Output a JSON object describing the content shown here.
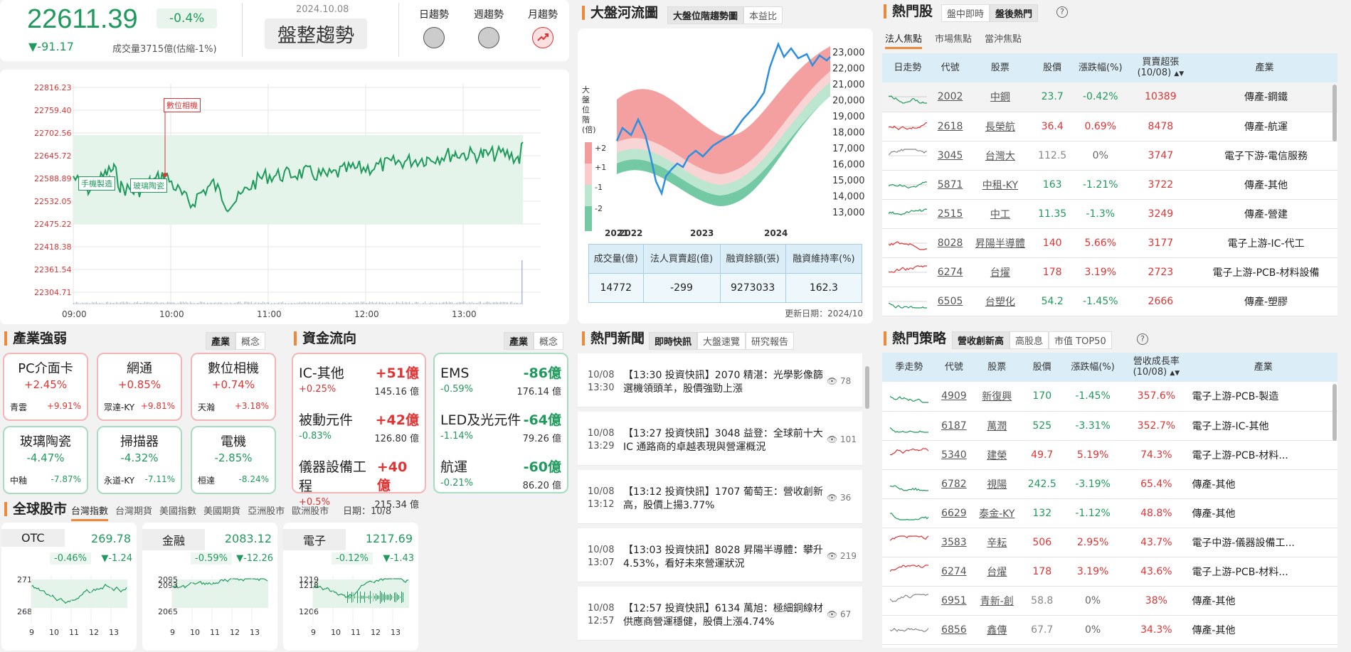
{
  "index": {
    "value": "22611.39",
    "pct": "-0.4%",
    "change": "▼-91.17",
    "volume": "成交量3715億(估縮-1%)",
    "date": "2024.10.08",
    "trend": "盤整趨勢",
    "trend_labels": [
      "日趨勢",
      "週趨勢",
      "月趨勢"
    ]
  },
  "intraday": {
    "yticks": [
      "22816.23",
      "22759.40",
      "22702.56",
      "22645.72",
      "22588.89",
      "22532.05",
      "22475.22",
      "22418.38",
      "22361.54",
      "22304.71"
    ],
    "xticks": [
      "09:00",
      "10:00",
      "11:00",
      "12:00",
      "13:00"
    ],
    "tags": [
      "數位相機",
      "手機製造",
      "玻璃陶瓷"
    ]
  },
  "river": {
    "title": "大盤河流圖",
    "tabs": [
      "大盤位階趨勢圖",
      "本益比"
    ],
    "ylabel": "大盤位階(倍)",
    "bands": [
      "+2",
      "+1",
      "-1",
      "-2"
    ],
    "yticks": [
      "23,000",
      "22,000",
      "21,000",
      "20,000",
      "19,000",
      "18,000",
      "17,000",
      "16,000",
      "15,000",
      "14,000",
      "13,000"
    ],
    "xticks": [
      "2021",
      "2022",
      "2023",
      "2024"
    ],
    "table_headers": [
      "成交量(億)",
      "法人買賣超(億)",
      "融資餘額(張)",
      "融資維持率(%)"
    ],
    "table_values": [
      "14772",
      "-299",
      "9273033",
      "162.3"
    ],
    "update": "更新日期：2024/10"
  },
  "hot": {
    "title": "熱門股",
    "tabs": [
      "盤中即時",
      "盤後熱門"
    ],
    "help": "?",
    "subtabs": [
      "法人焦點",
      "市場焦點",
      "當沖焦點"
    ],
    "headers": [
      "日走勢",
      "代號",
      "股票",
      "股價",
      "漲跌幅(%)",
      "買賣超張\n(10/08)",
      "產業"
    ],
    "rows": [
      [
        "2002",
        "中鋼",
        "23.7",
        "-0.42%",
        "10389",
        "傳產-鋼鐵"
      ],
      [
        "2618",
        "長榮航",
        "36.4",
        "0.69%",
        "8478",
        "傳產-航運"
      ],
      [
        "3045",
        "台灣大",
        "112.5",
        "0%",
        "3747",
        "電子下游-電信服務"
      ],
      [
        "5871",
        "中租-KY",
        "163",
        "-1.21%",
        "3722",
        "傳產-其他"
      ],
      [
        "2515",
        "中工",
        "11.35",
        "-1.3%",
        "3249",
        "傳產-營建"
      ],
      [
        "8028",
        "昇陽半導體",
        "140",
        "5.66%",
        "3177",
        "電子上游-IC-代工"
      ],
      [
        "6274",
        "台燿",
        "178",
        "3.19%",
        "2723",
        "電子上游-PCB-材料設備"
      ],
      [
        "6505",
        "台塑化",
        "54.2",
        "-1.45%",
        "2666",
        "傳產-塑膠"
      ]
    ]
  },
  "strategy": {
    "title": "熱門策略",
    "tabs": [
      "營收創新高",
      "高股息",
      "市值 TOP50"
    ],
    "help": "?",
    "headers": [
      "季走勢",
      "代號",
      "股票",
      "股價",
      "漲跌幅(%)",
      "營收成長率\n(10/08)",
      "產業"
    ],
    "rows": [
      [
        "4909",
        "新復興",
        "170",
        "-1.45%",
        "357.6%",
        "電子上游-PCB-製造"
      ],
      [
        "6187",
        "萬潤",
        "525",
        "-3.31%",
        "352.7%",
        "電子上游-IC-其他"
      ],
      [
        "5340",
        "建榮",
        "49.7",
        "5.19%",
        "74.3%",
        "電子上游-PCB-材料..."
      ],
      [
        "6782",
        "視陽",
        "242.5",
        "-3.19%",
        "65.4%",
        "傳產-其他"
      ],
      [
        "6629",
        "泰金-KY",
        "132",
        "-1.12%",
        "48.8%",
        "傳產-其他"
      ],
      [
        "3583",
        "辛耘",
        "506",
        "2.95%",
        "43.7%",
        "電子中游-儀器設備工..."
      ],
      [
        "6274",
        "台燿",
        "178",
        "3.19%",
        "43.6%",
        "電子上游-PCB-材料..."
      ],
      [
        "6951",
        "青新-創",
        "58.8",
        "0%",
        "38%",
        "傳產-其他"
      ],
      [
        "6856",
        "鑫傳",
        "67.7",
        "0%",
        "34.3%",
        "傳產-其他"
      ]
    ]
  },
  "industry": {
    "title": "產業強弱",
    "tabs": [
      "產業",
      "概念"
    ],
    "boxes": [
      {
        "name": "PC介面卡",
        "pct": "+2.45%",
        "sub": "青雲",
        "subpct": "+9.91%",
        "dir": "up"
      },
      {
        "name": "網通",
        "pct": "+0.85%",
        "sub": "眾達-KY",
        "subpct": "+9.81%",
        "dir": "up"
      },
      {
        "name": "數位相機",
        "pct": "+0.74%",
        "sub": "天瀚",
        "subpct": "+3.18%",
        "dir": "up"
      },
      {
        "name": "玻璃陶瓷",
        "pct": "-4.47%",
        "sub": "中釉",
        "subpct": "-7.87%",
        "dir": "dn"
      },
      {
        "name": "掃描器",
        "pct": "-4.32%",
        "sub": "永道-KY",
        "subpct": "-7.11%",
        "dir": "dn"
      },
      {
        "name": "電機",
        "pct": "-2.85%",
        "sub": "桓達",
        "subpct": "-8.24%",
        "dir": "dn"
      }
    ]
  },
  "fund": {
    "title": "資金流向",
    "tabs": [
      "產業",
      "概念"
    ],
    "up": [
      {
        "name": "IC-其他",
        "amt": "+51億",
        "pct": "+0.25%",
        "total": "145.16 億"
      },
      {
        "name": "被動元件",
        "amt": "+42億",
        "pct": "-0.83%",
        "total": "126.80 億"
      },
      {
        "name": "儀器設備工程",
        "amt": "+40億",
        "pct": "+0.5%",
        "total": "215.34 億"
      }
    ],
    "dn": [
      {
        "name": "EMS",
        "amt": "-86億",
        "pct": "-0.59%",
        "total": "176.14 億"
      },
      {
        "name": "LED及光元件",
        "amt": "-64億",
        "pct": "-1.14%",
        "total": "79.26 億"
      },
      {
        "name": "航運",
        "amt": "-60億",
        "pct": "-0.21%",
        "total": "86.20 億"
      }
    ]
  },
  "global": {
    "title": "全球股市",
    "tabs": [
      "台灣指數",
      "台灣期貨",
      "美國指數",
      "美國期貨",
      "亞洲股市",
      "歐洲股市"
    ],
    "date": "日期：10/8",
    "cards": [
      {
        "name": "OTC",
        "value": "269.78",
        "pct": "-0.46%",
        "chg": "▼-1.24",
        "ymax": "271",
        "ymin": "268"
      },
      {
        "name": "金融",
        "value": "2083.12",
        "pct": "-0.59%",
        "chg": "▼-12.26",
        "ymax": "2095",
        "ymin": "2065",
        "y2": "2093"
      },
      {
        "name": "電子",
        "value": "1217.69",
        "pct": "-0.12%",
        "chg": "▼-1.43",
        "ymax": "1219",
        "ymin": "1206",
        "y2": "1218"
      }
    ],
    "xticks": [
      "9",
      "10",
      "11",
      "12",
      "13"
    ]
  },
  "news": {
    "title": "熱門新聞",
    "tabs": [
      "即時快訊",
      "大盤速覽",
      "研究報告"
    ],
    "items": [
      {
        "date": "10/08",
        "time": "13:30",
        "text": "【13:30 投資快訊】2070 精湛：光學影像篩選機領頭羊，股價強勁上漲",
        "views": "78"
      },
      {
        "date": "10/08",
        "time": "13:29",
        "text": "【13:27 投資快訊】3048 益登：全球前十大 IC 通路商的卓越表現與營運概況",
        "views": "101"
      },
      {
        "date": "10/08",
        "time": "13:12",
        "text": "【13:12 投資快訊】1707 葡萄王：營收創新高，股價上揚3.77%",
        "views": "36"
      },
      {
        "date": "10/08",
        "time": "13:07",
        "text": "【13:03 投資快訊】8028 昇陽半導體：攀升4.53%，看好未來營運狀況",
        "views": "219"
      },
      {
        "date": "10/08",
        "time": "12:57",
        "text": "【12:57 投資快訊】6134 萬旭：極細銅線材供應商營運穩健，股價上漲4.74%",
        "views": "67"
      }
    ]
  }
}
